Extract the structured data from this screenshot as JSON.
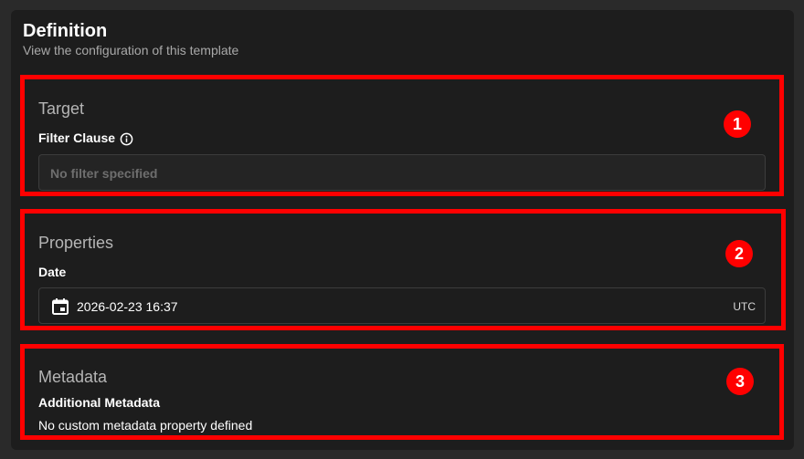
{
  "header": {
    "title": "Definition",
    "subtitle": "View the configuration of this template"
  },
  "sections": {
    "target": {
      "title": "Target",
      "filter_label": "Filter Clause",
      "filter_placeholder": "No filter specified",
      "badge": "1"
    },
    "properties": {
      "title": "Properties",
      "date_label": "Date",
      "date_value": "2026-02-23 16:37",
      "timezone": "UTC",
      "badge": "2"
    },
    "metadata": {
      "title": "Metadata",
      "additional_label": "Additional Metadata",
      "empty_text": "No custom metadata property defined",
      "badge": "3"
    }
  },
  "icons": {
    "info": "info-icon",
    "calendar": "calendar-icon"
  },
  "colors": {
    "highlight": "#ff0000",
    "panel_bg": "#1d1d1d",
    "page_bg": "#2a2a2a"
  }
}
